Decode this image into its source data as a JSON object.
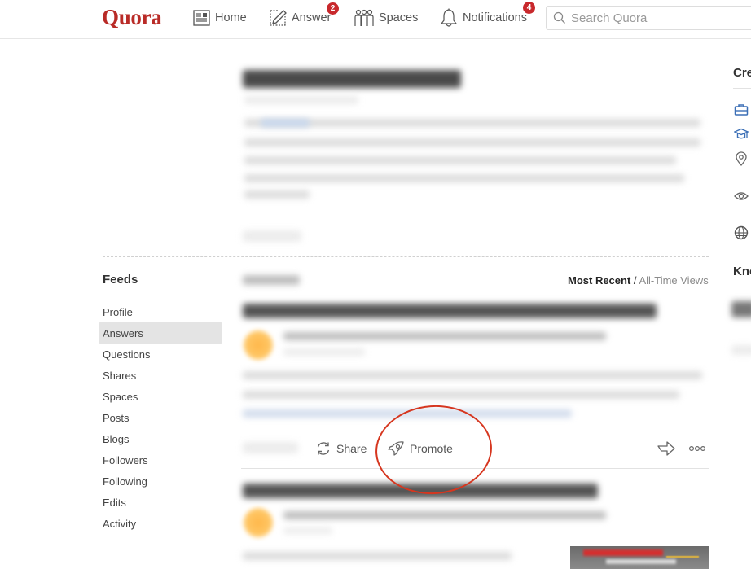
{
  "header": {
    "logo": "Quora",
    "nav": [
      {
        "label": "Home",
        "icon": "home-feed-icon"
      },
      {
        "label": "Answer",
        "icon": "pencil-icon",
        "badge": "2"
      },
      {
        "label": "Spaces",
        "icon": "spaces-people-icon"
      },
      {
        "label": "Notifications",
        "icon": "bell-icon",
        "badge": "4"
      }
    ],
    "search": {
      "placeholder": "Search Quora",
      "value": ""
    }
  },
  "sidebar": {
    "title": "Feeds",
    "items": [
      {
        "label": "Profile",
        "active": false
      },
      {
        "label": "Answers",
        "active": true
      },
      {
        "label": "Questions",
        "active": false
      },
      {
        "label": "Shares",
        "active": false
      },
      {
        "label": "Spaces",
        "active": false
      },
      {
        "label": "Posts",
        "active": false
      },
      {
        "label": "Blogs",
        "active": false
      },
      {
        "label": "Followers",
        "active": false
      },
      {
        "label": "Following",
        "active": false
      },
      {
        "label": "Edits",
        "active": false
      },
      {
        "label": "Activity",
        "active": false
      }
    ]
  },
  "feed": {
    "sort": {
      "active": "Most Recent",
      "separator": "/",
      "inactive": "All-Time Views"
    },
    "actions": {
      "share": "Share",
      "promote": "Promote",
      "downvote_icon": "downvote-arrow-icon",
      "more_icon": "more-options-icon"
    }
  },
  "right_panel": {
    "credentials_heading": "Cre",
    "knows_heading": "Kno",
    "icons": [
      "briefcase-icon",
      "graduation-cap-icon",
      "location-pin-icon",
      "eye-icon",
      "globe-icon"
    ]
  },
  "colors": {
    "brand": "#b92b27",
    "badge": "#c8282c",
    "annotation": "#d6361f",
    "credential_icon": "#3b6fb6"
  }
}
